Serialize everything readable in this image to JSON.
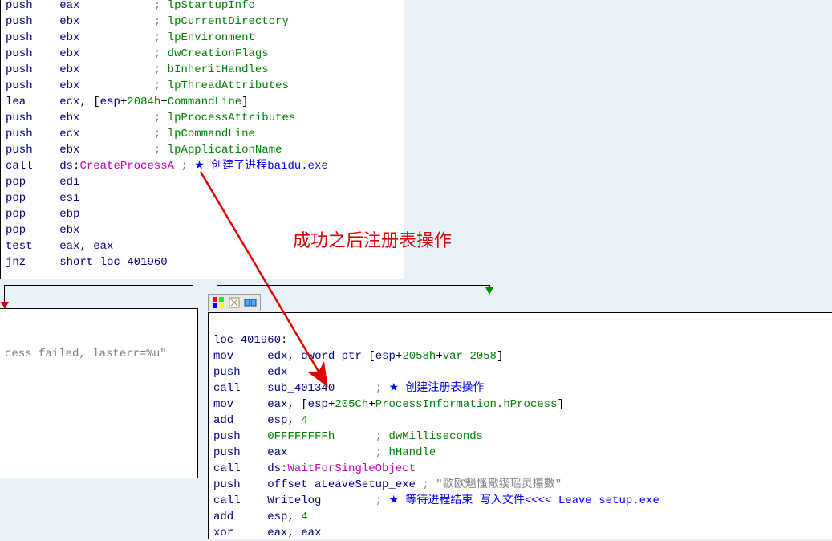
{
  "annotation": "成功之后注册表操作",
  "box1": {
    "lines": [
      [
        {
          "t": "push",
          "c": "mnem"
        },
        {
          "t": "    "
        },
        {
          "t": "eax",
          "c": "reg"
        },
        {
          "t": "           "
        },
        {
          "t": "; ",
          "c": "cmt"
        },
        {
          "t": "lpStartupInfo",
          "c": "sym"
        }
      ],
      [
        {
          "t": "push",
          "c": "mnem"
        },
        {
          "t": "    "
        },
        {
          "t": "ebx",
          "c": "reg"
        },
        {
          "t": "           "
        },
        {
          "t": "; ",
          "c": "cmt"
        },
        {
          "t": "lpCurrentDirectory",
          "c": "sym"
        }
      ],
      [
        {
          "t": "push",
          "c": "mnem"
        },
        {
          "t": "    "
        },
        {
          "t": "ebx",
          "c": "reg"
        },
        {
          "t": "           "
        },
        {
          "t": "; ",
          "c": "cmt"
        },
        {
          "t": "lpEnvironment",
          "c": "sym"
        }
      ],
      [
        {
          "t": "push",
          "c": "mnem"
        },
        {
          "t": "    "
        },
        {
          "t": "ebx",
          "c": "reg"
        },
        {
          "t": "           "
        },
        {
          "t": "; ",
          "c": "cmt"
        },
        {
          "t": "dwCreationFlags",
          "c": "sym"
        }
      ],
      [
        {
          "t": "push",
          "c": "mnem"
        },
        {
          "t": "    "
        },
        {
          "t": "ebx",
          "c": "reg"
        },
        {
          "t": "           "
        },
        {
          "t": "; ",
          "c": "cmt"
        },
        {
          "t": "bInheritHandles",
          "c": "sym"
        }
      ],
      [
        {
          "t": "push",
          "c": "mnem"
        },
        {
          "t": "    "
        },
        {
          "t": "ebx",
          "c": "reg"
        },
        {
          "t": "           "
        },
        {
          "t": "; ",
          "c": "cmt"
        },
        {
          "t": "lpThreadAttributes",
          "c": "sym"
        }
      ],
      [
        {
          "t": "lea",
          "c": "mnem"
        },
        {
          "t": "     "
        },
        {
          "t": "ecx",
          "c": "reg"
        },
        {
          "t": ", ["
        },
        {
          "t": "esp",
          "c": "reg"
        },
        {
          "t": "+"
        },
        {
          "t": "2084h",
          "c": "num"
        },
        {
          "t": "+"
        },
        {
          "t": "CommandLine",
          "c": "sym"
        },
        {
          "t": "]"
        }
      ],
      [
        {
          "t": "push",
          "c": "mnem"
        },
        {
          "t": "    "
        },
        {
          "t": "ebx",
          "c": "reg"
        },
        {
          "t": "           "
        },
        {
          "t": "; ",
          "c": "cmt"
        },
        {
          "t": "lpProcessAttributes",
          "c": "sym"
        }
      ],
      [
        {
          "t": "push",
          "c": "mnem"
        },
        {
          "t": "    "
        },
        {
          "t": "ecx",
          "c": "reg"
        },
        {
          "t": "           "
        },
        {
          "t": "; ",
          "c": "cmt"
        },
        {
          "t": "lpCommandLine",
          "c": "sym"
        }
      ],
      [
        {
          "t": "push",
          "c": "mnem"
        },
        {
          "t": "    "
        },
        {
          "t": "ebx",
          "c": "reg"
        },
        {
          "t": "           "
        },
        {
          "t": "; ",
          "c": "cmt"
        },
        {
          "t": "lpApplicationName",
          "c": "sym"
        }
      ],
      [
        {
          "t": "call",
          "c": "mnem"
        },
        {
          "t": "    "
        },
        {
          "t": "ds",
          "c": "reg"
        },
        {
          "t": ":"
        },
        {
          "t": "CreateProcessA",
          "c": "imp"
        },
        {
          "t": " "
        },
        {
          "t": "; ",
          "c": "cmt"
        },
        {
          "t": "★ ",
          "c": "star"
        },
        {
          "t": "创建了进程baidu.exe",
          "c": "starcmt"
        }
      ],
      [
        {
          "t": "pop",
          "c": "mnem"
        },
        {
          "t": "     "
        },
        {
          "t": "edi",
          "c": "reg"
        }
      ],
      [
        {
          "t": "pop",
          "c": "mnem"
        },
        {
          "t": "     "
        },
        {
          "t": "esi",
          "c": "reg"
        }
      ],
      [
        {
          "t": "pop",
          "c": "mnem"
        },
        {
          "t": "     "
        },
        {
          "t": "ebp",
          "c": "reg"
        }
      ],
      [
        {
          "t": "pop",
          "c": "mnem"
        },
        {
          "t": "     "
        },
        {
          "t": "ebx",
          "c": "reg"
        }
      ],
      [
        {
          "t": "test",
          "c": "mnem"
        },
        {
          "t": "    "
        },
        {
          "t": "eax",
          "c": "reg"
        },
        {
          "t": ", "
        },
        {
          "t": "eax",
          "c": "reg"
        }
      ],
      [
        {
          "t": "jnz",
          "c": "mnem"
        },
        {
          "t": "     "
        },
        {
          "t": "short",
          "c": "kw"
        },
        {
          "t": " "
        },
        {
          "t": "loc_401960",
          "c": "lbl"
        }
      ]
    ]
  },
  "box2": {
    "lines": [
      [
        {
          "t": "cess failed, lasterr=%u\"",
          "c": "cmt"
        }
      ]
    ]
  },
  "box3": {
    "lines": [
      [],
      [
        {
          "t": "loc_401960",
          "c": "lbl"
        },
        {
          "t": ":"
        }
      ],
      [
        {
          "t": "mov",
          "c": "mnem"
        },
        {
          "t": "     "
        },
        {
          "t": "edx",
          "c": "reg"
        },
        {
          "t": ", "
        },
        {
          "t": "dword ptr",
          "c": "kw"
        },
        {
          "t": " ["
        },
        {
          "t": "esp",
          "c": "reg"
        },
        {
          "t": "+"
        },
        {
          "t": "2058h",
          "c": "num"
        },
        {
          "t": "+"
        },
        {
          "t": "var_2058",
          "c": "sym"
        },
        {
          "t": "]"
        }
      ],
      [
        {
          "t": "push",
          "c": "mnem"
        },
        {
          "t": "    "
        },
        {
          "t": "edx",
          "c": "reg"
        }
      ],
      [
        {
          "t": "call",
          "c": "mnem"
        },
        {
          "t": "    "
        },
        {
          "t": "sub_401340",
          "c": "lbl"
        },
        {
          "t": "      "
        },
        {
          "t": "; ",
          "c": "cmt"
        },
        {
          "t": "★ ",
          "c": "star"
        },
        {
          "t": "创建注册表操作",
          "c": "starcmt"
        }
      ],
      [
        {
          "t": "mov",
          "c": "mnem"
        },
        {
          "t": "     "
        },
        {
          "t": "eax",
          "c": "reg"
        },
        {
          "t": ", ["
        },
        {
          "t": "esp",
          "c": "reg"
        },
        {
          "t": "+"
        },
        {
          "t": "205Ch",
          "c": "num"
        },
        {
          "t": "+"
        },
        {
          "t": "ProcessInformation.hProcess",
          "c": "sym"
        },
        {
          "t": "]"
        }
      ],
      [
        {
          "t": "add",
          "c": "mnem"
        },
        {
          "t": "     "
        },
        {
          "t": "esp",
          "c": "reg"
        },
        {
          "t": ", "
        },
        {
          "t": "4",
          "c": "num"
        }
      ],
      [
        {
          "t": "push",
          "c": "mnem"
        },
        {
          "t": "    "
        },
        {
          "t": "0FFFFFFFFh",
          "c": "num"
        },
        {
          "t": "      "
        },
        {
          "t": "; ",
          "c": "cmt"
        },
        {
          "t": "dwMilliseconds",
          "c": "sym"
        }
      ],
      [
        {
          "t": "push",
          "c": "mnem"
        },
        {
          "t": "    "
        },
        {
          "t": "eax",
          "c": "reg"
        },
        {
          "t": "             "
        },
        {
          "t": "; ",
          "c": "cmt"
        },
        {
          "t": "hHandle",
          "c": "sym"
        }
      ],
      [
        {
          "t": "call",
          "c": "mnem"
        },
        {
          "t": "    "
        },
        {
          "t": "ds",
          "c": "reg"
        },
        {
          "t": ":"
        },
        {
          "t": "WaitForSingleObject",
          "c": "imp"
        }
      ],
      [
        {
          "t": "push",
          "c": "mnem"
        },
        {
          "t": "    "
        },
        {
          "t": "offset",
          "c": "kw"
        },
        {
          "t": " "
        },
        {
          "t": "aLeaveSetup_exe",
          "c": "lbl"
        },
        {
          "t": " "
        },
        {
          "t": "; \"歐欧魈慅儆猰瑶灵攥數\"",
          "c": "cmt"
        }
      ],
      [
        {
          "t": "call",
          "c": "mnem"
        },
        {
          "t": "    "
        },
        {
          "t": "Writelog",
          "c": "lbl"
        },
        {
          "t": "        "
        },
        {
          "t": "; ",
          "c": "cmt"
        },
        {
          "t": "★ ",
          "c": "star"
        },
        {
          "t": "等待进程结束 写入文件<<<< Leave setup.exe",
          "c": "starcmt"
        }
      ],
      [
        {
          "t": "add",
          "c": "mnem"
        },
        {
          "t": "     "
        },
        {
          "t": "esp",
          "c": "reg"
        },
        {
          "t": ", "
        },
        {
          "t": "4",
          "c": "num"
        }
      ],
      [
        {
          "t": "xor",
          "c": "mnem"
        },
        {
          "t": "     "
        },
        {
          "t": "eax",
          "c": "reg"
        },
        {
          "t": ", "
        },
        {
          "t": "eax",
          "c": "reg"
        }
      ]
    ]
  }
}
